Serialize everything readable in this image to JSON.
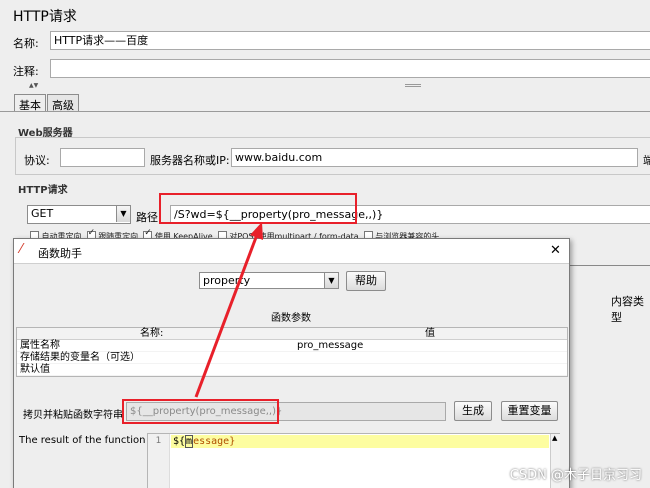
{
  "window": {
    "title": "HTTP请求"
  },
  "form": {
    "name_label": "名称:",
    "name_value": "HTTP请求——百度",
    "comment_label": "注释:",
    "comment_value": ""
  },
  "tabs": [
    {
      "label": "基本"
    },
    {
      "label": "高级"
    }
  ],
  "web_server": {
    "heading": "Web服务器",
    "protocol_label": "协议:",
    "protocol_value": "",
    "server_label": "服务器名称或IP:",
    "server_value": "www.baidu.com",
    "port_label_partial": "端"
  },
  "http_request": {
    "heading": "HTTP请求",
    "method": "GET",
    "path_label": "路径:",
    "path_value": "/S?wd=${__property(pro_message,,)}",
    "options": [
      {
        "label": "自动重定向",
        "checked": false
      },
      {
        "label": "跟随重定向",
        "checked": true
      },
      {
        "label": "使用 KeepAlive",
        "checked": true
      },
      {
        "label": "对POST使用multipart / form-data",
        "checked": false
      },
      {
        "label": "与浏览器兼容的头",
        "checked": false
      }
    ],
    "content_type_label": "内容类型"
  },
  "dialog": {
    "title": "函数助手",
    "close_glyph": "✕",
    "function_selected": "property",
    "help_button": "帮助",
    "params_heading": "函数参数",
    "table": {
      "columns": [
        "名称:",
        "值"
      ],
      "rows": [
        {
          "name": "属性名称",
          "value": "pro_message"
        },
        {
          "name": "存储结果的变量名（可选）",
          "value": ""
        },
        {
          "name": "默认值",
          "value": ""
        }
      ]
    },
    "copy_label": "拷贝并粘贴函数字符串",
    "function_string": "${__property(pro_message,,)}",
    "generate_button": "生成",
    "reset_button": "重置变量",
    "result_label": "The result of the function is",
    "result_line_number": "1",
    "result_value_prefix": "${",
    "result_value_cursor": "m",
    "result_value_rest": "essage}"
  },
  "watermark": "CSDN @木子日京习习",
  "colors": {
    "highlight_red": "#e8202a",
    "editor_highlight": "#fdfda0",
    "feather": "#d23a2a"
  },
  "icons": [
    "jmeter-feather-icon",
    "dropdown-arrow-icon",
    "close-icon",
    "scroll-up-icon"
  ]
}
